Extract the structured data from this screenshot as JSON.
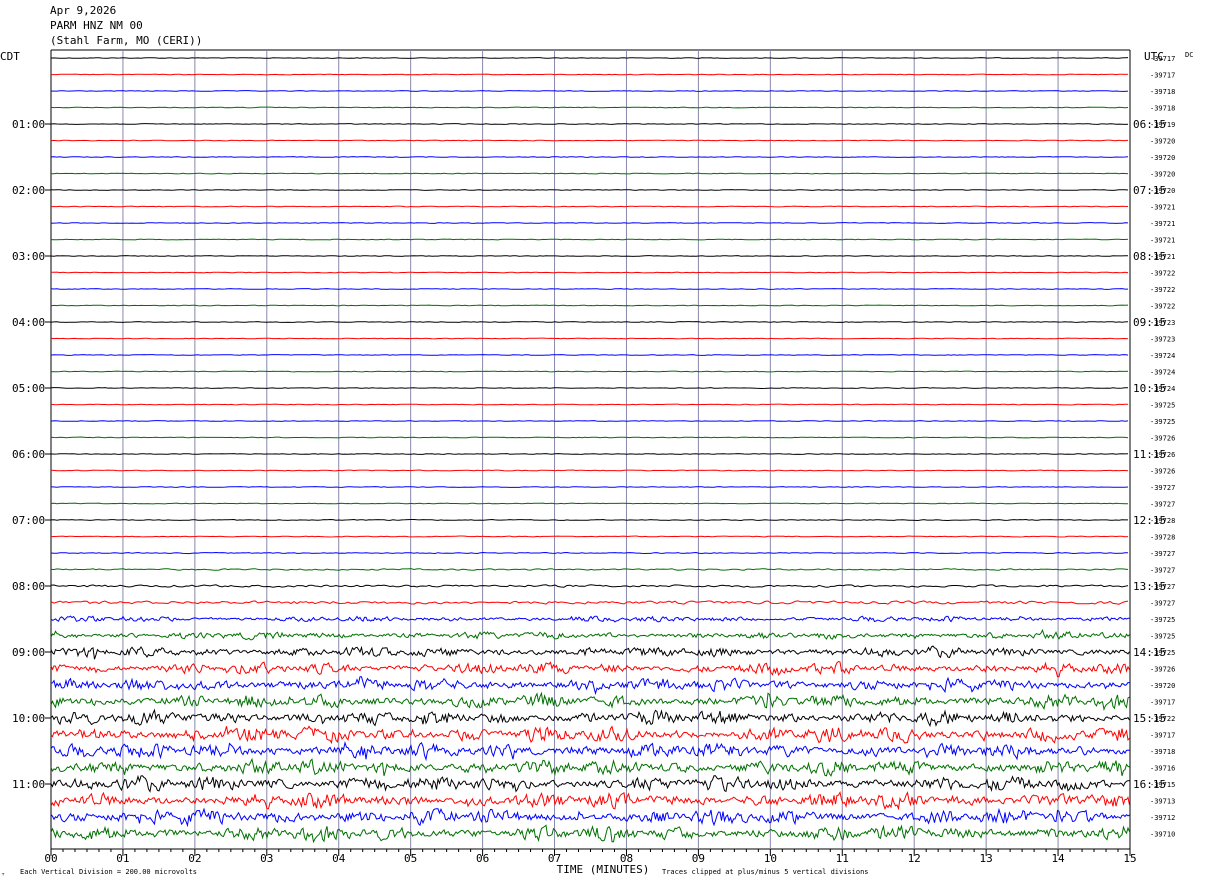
{
  "header": {
    "date": "Apr 9,2026",
    "station": "PARM HNZ NM 00",
    "location": "(Stahl Farm, MO (CERI))"
  },
  "footer": {
    "scale_note": "Each Vertical Division =  200.00 microvolts",
    "clip_note": "Traces clipped at plus/minus 5 vertical divisions",
    "corner_mark": "ᵀ"
  },
  "chart_data": {
    "type": "line",
    "title": "",
    "xlabel": "TIME (MINUTES)",
    "left_axis_label": "CDT",
    "right_axis_label": "UTC",
    "dc_label": "DC",
    "xlim": [
      0,
      15
    ],
    "x_ticks": [
      "00",
      "01",
      "02",
      "03",
      "04",
      "05",
      "06",
      "07",
      "08",
      "09",
      "10",
      "11",
      "12",
      "13",
      "14",
      "15"
    ],
    "trace_interval_minutes": 15,
    "trace_colors": [
      "#000000",
      "#ff0000",
      "#0000ff",
      "#007000"
    ],
    "cdt_hour_labels": [
      "01:00",
      "02:00",
      "03:00",
      "04:00",
      "05:00",
      "06:00",
      "07:00",
      "08:00",
      "09:00",
      "10:00",
      "11:00"
    ],
    "utc_hour_labels": [
      "06:15",
      "07:15",
      "08:15",
      "09:15",
      "10:15",
      "11:15",
      "12:15",
      "13:15",
      "14:15",
      "15:15",
      "16:15"
    ],
    "dc_offsets": [
      -39717,
      -39717,
      -39718,
      -39718,
      -39719,
      -39720,
      -39720,
      -39720,
      -39720,
      -39721,
      -39721,
      -39721,
      -39721,
      -39722,
      -39722,
      -39722,
      -39723,
      -39723,
      -39724,
      -39724,
      -39724,
      -39725,
      -39725,
      -39726,
      -39726,
      -39726,
      -39727,
      -39727,
      -39728,
      -39728,
      -39727,
      -39727,
      -39727,
      -39727,
      -39725,
      -39725,
      -39725,
      -39726,
      -39720,
      -39717,
      -39722,
      -39717,
      -39718,
      -39716,
      -39715,
      -39713,
      -39712,
      -39710
    ],
    "trace_amplitude_divisions": [
      0.3,
      0.3,
      0.3,
      0.3,
      0.3,
      0.3,
      0.3,
      0.3,
      0.3,
      0.3,
      0.3,
      0.3,
      0.3,
      0.3,
      0.3,
      0.3,
      0.3,
      0.3,
      0.3,
      0.3,
      0.3,
      0.3,
      0.3,
      0.3,
      0.3,
      0.35,
      0.3,
      0.3,
      0.35,
      0.35,
      0.4,
      0.6,
      0.9,
      1.2,
      1.8,
      2.4,
      3.4,
      3.8,
      4.2,
      4.6,
      4.8,
      5,
      5,
      5,
      5,
      5,
      5,
      5
    ]
  }
}
